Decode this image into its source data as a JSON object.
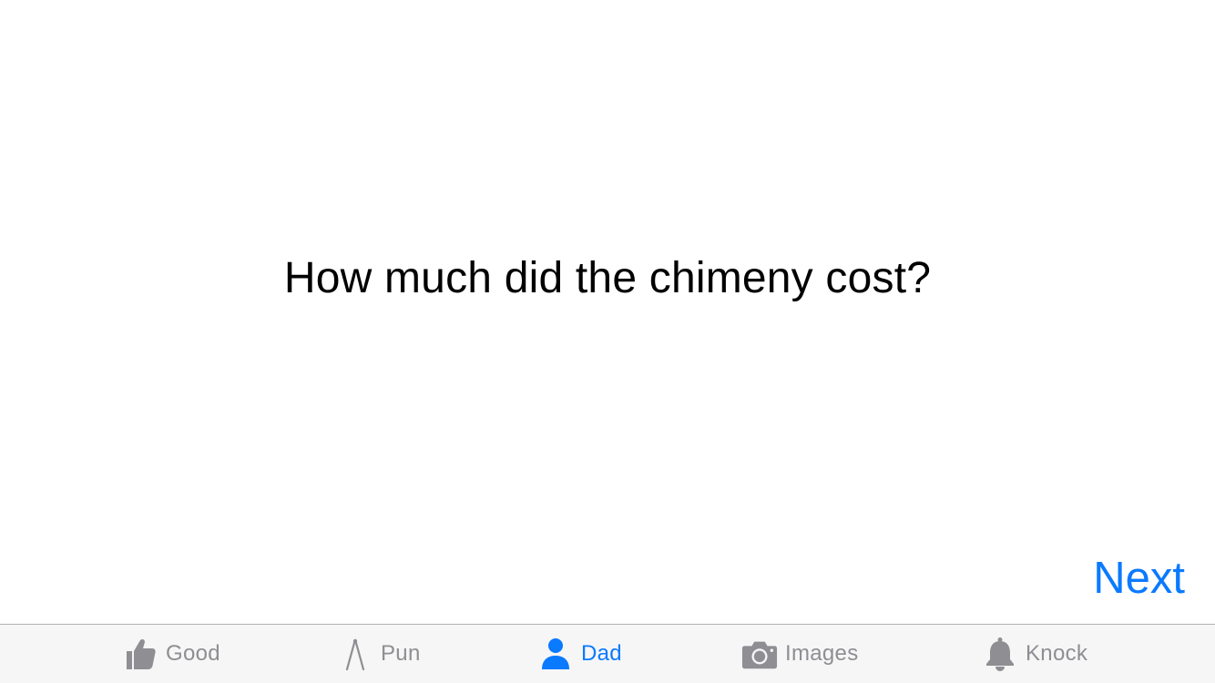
{
  "joke": {
    "text": "How much did the chimeny cost?"
  },
  "actions": {
    "next_label": "Next"
  },
  "colors": {
    "accent": "#0a7aff",
    "inactive": "#8e8e93",
    "text": "#000000",
    "tabbar_bg": "#f6f6f6"
  },
  "tabbar": {
    "selected": "dad",
    "tabs": [
      {
        "id": "good",
        "label": "Good",
        "icon": "thumbs-up-icon"
      },
      {
        "id": "pun",
        "label": "Pun",
        "icon": "compass-icon"
      },
      {
        "id": "dad",
        "label": "Dad",
        "icon": "person-icon"
      },
      {
        "id": "images",
        "label": "Images",
        "icon": "camera-icon"
      },
      {
        "id": "knock",
        "label": "Knock",
        "icon": "bell-icon"
      }
    ]
  }
}
